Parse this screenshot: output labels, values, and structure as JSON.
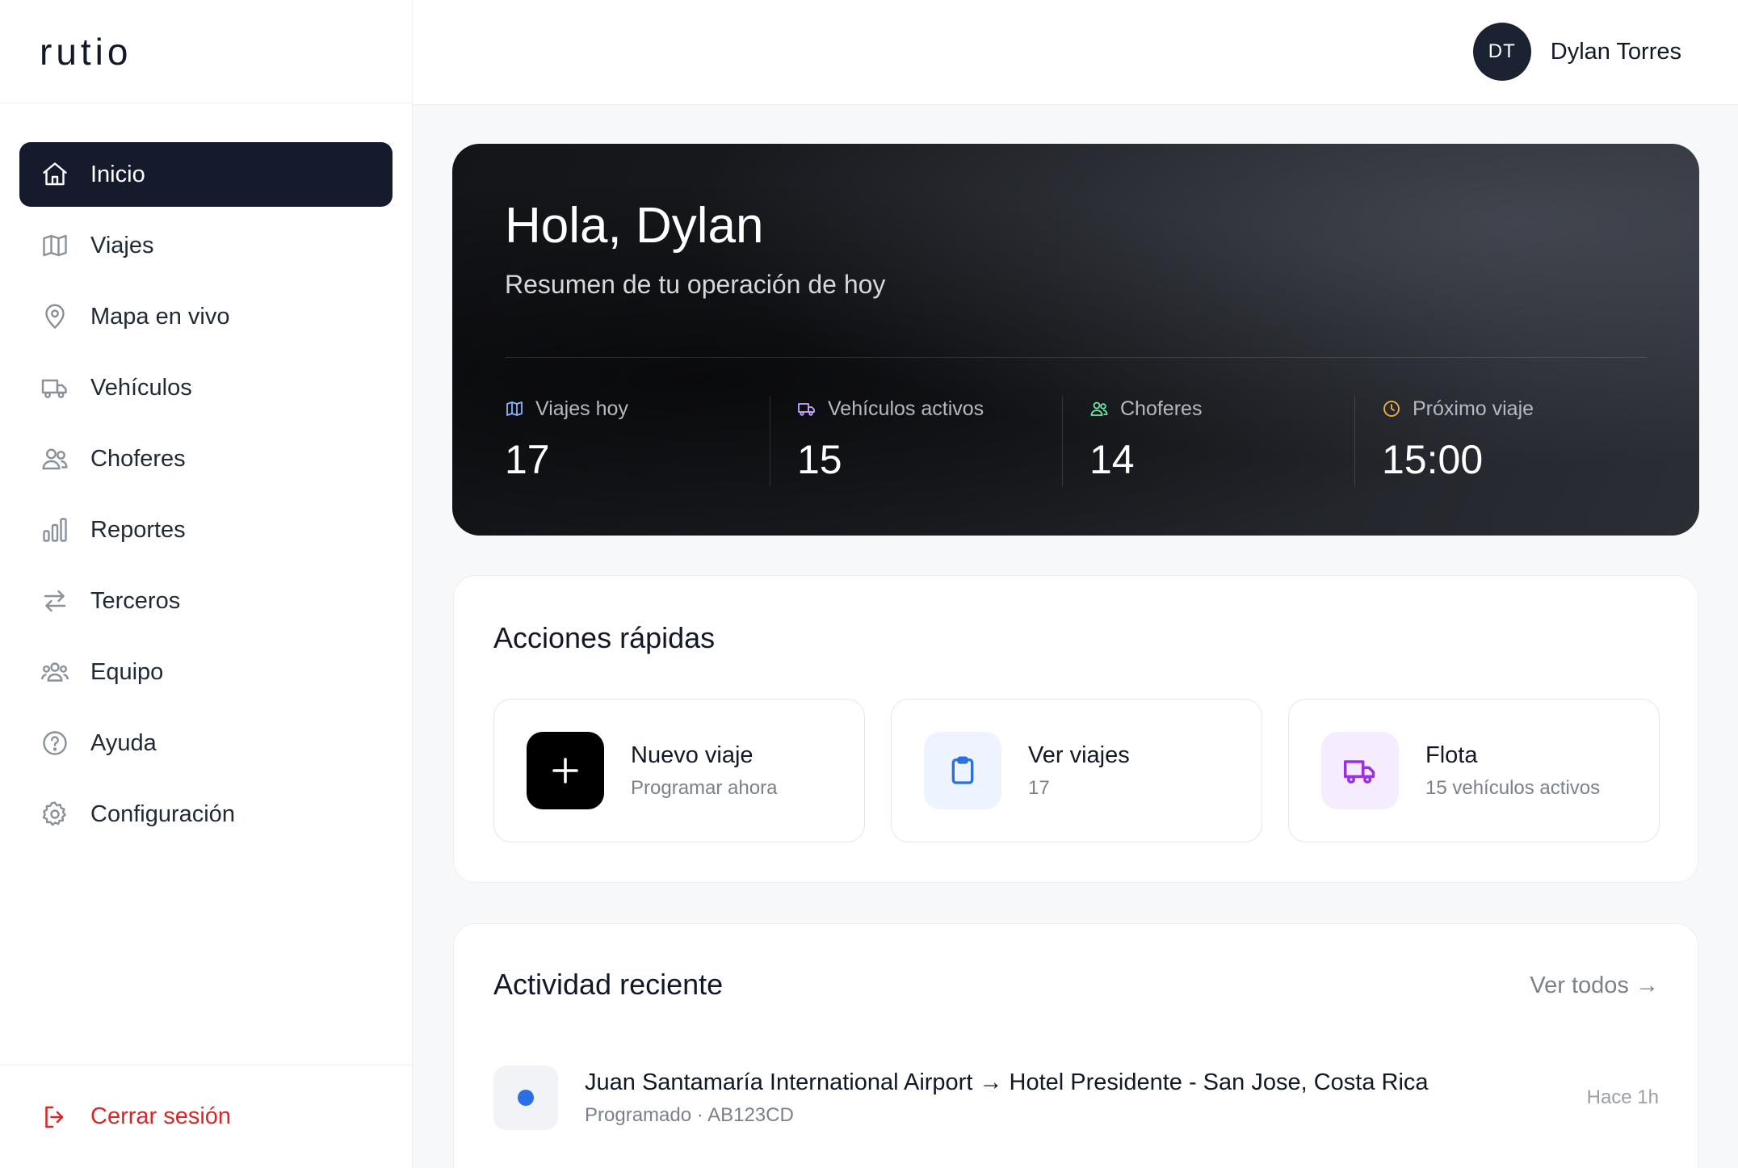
{
  "app": {
    "logo": "rutio"
  },
  "user": {
    "initials": "DT",
    "name": "Dylan Torres"
  },
  "sidebar": {
    "items": [
      {
        "label": "Inicio",
        "icon": "home-icon",
        "active": true
      },
      {
        "label": "Viajes",
        "icon": "map-icon"
      },
      {
        "label": "Mapa en vivo",
        "icon": "map-pin-icon"
      },
      {
        "label": "Vehículos",
        "icon": "truck-icon"
      },
      {
        "label": "Choferes",
        "icon": "users-icon"
      },
      {
        "label": "Reportes",
        "icon": "bar-chart-icon"
      },
      {
        "label": "Terceros",
        "icon": "arrows-exchange-icon"
      },
      {
        "label": "Equipo",
        "icon": "team-icon"
      },
      {
        "label": "Ayuda",
        "icon": "help-circle-icon"
      },
      {
        "label": "Configuración",
        "icon": "gear-icon"
      }
    ],
    "logout": {
      "label": "Cerrar sesión",
      "icon": "logout-icon"
    }
  },
  "hero": {
    "title": "Hola, Dylan",
    "subtitle": "Resumen de tu operación de hoy",
    "stats": [
      {
        "label": "Viajes hoy",
        "value": "17",
        "icon": "map-icon",
        "color": "#8fb4ff"
      },
      {
        "label": "Vehículos activos",
        "value": "15",
        "icon": "truck-icon",
        "color": "#c9a6ff"
      },
      {
        "label": "Choferes",
        "value": "14",
        "icon": "users-icon",
        "color": "#6ee7a8"
      },
      {
        "label": "Próximo viaje",
        "value": "15:00",
        "icon": "clock-icon",
        "color": "#f5b341"
      }
    ]
  },
  "quick_actions": {
    "title": "Acciones rápidas",
    "items": [
      {
        "title": "Nuevo viaje",
        "subtitle": "Programar ahora",
        "icon": "plus-icon",
        "bg": "#000000",
        "fg": "#ffffff"
      },
      {
        "title": "Ver viajes",
        "subtitle": "17",
        "icon": "clipboard-icon",
        "bg": "#eef4ff",
        "fg": "#2b6fe6"
      },
      {
        "title": "Flota",
        "subtitle": "15 vehículos activos",
        "icon": "truck-icon",
        "bg": "#f6ecff",
        "fg": "#9b30e0"
      }
    ]
  },
  "activity": {
    "title": "Actividad reciente",
    "see_all": "Ver todos →",
    "items": [
      {
        "title": "Juan Santamaría International Airport → Hotel Presidente - San Jose, Costa Rica",
        "subtitle": "Programado · AB123CD",
        "time": "Hace 1h",
        "dot_color": "#2b6fe6"
      }
    ]
  }
}
